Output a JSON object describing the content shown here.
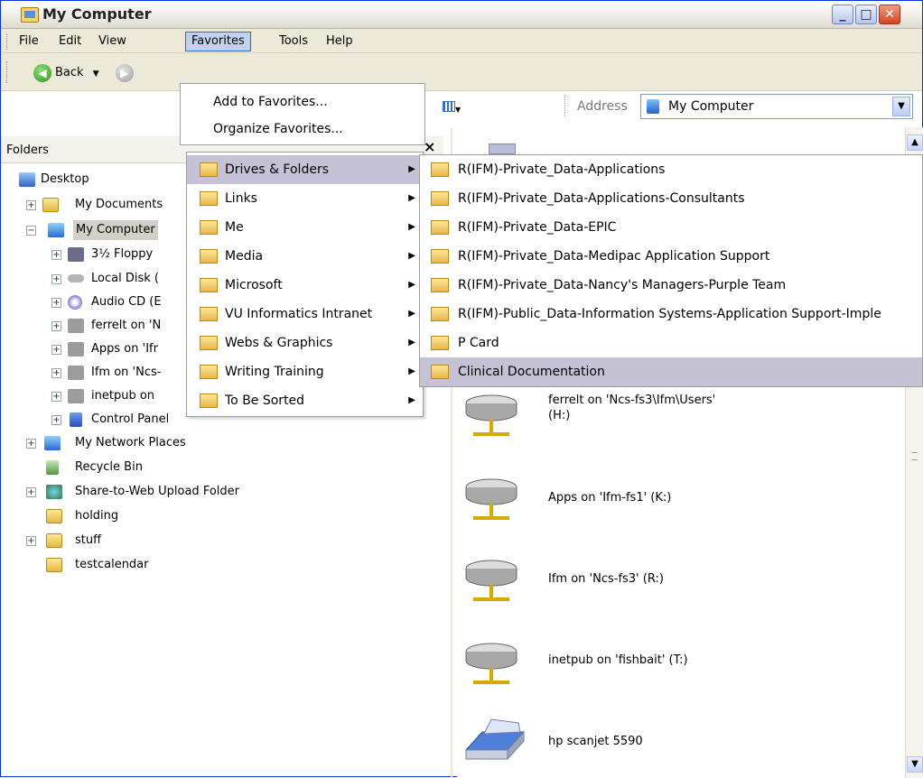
{
  "window": {
    "title": "My Computer"
  },
  "menubar": [
    "File",
    "Edit",
    "View",
    "Favorites",
    "Tools",
    "Help"
  ],
  "toolbar": {
    "back_label": "Back",
    "address_label": "Address",
    "address_value": "My Computer"
  },
  "folders_pane": {
    "header": "Folders"
  },
  "tree": [
    {
      "label": "Desktop"
    },
    {
      "label": "My Documents"
    },
    {
      "label": "My Computer"
    },
    {
      "label": "3½ Floppy"
    },
    {
      "label": "Local Disk ("
    },
    {
      "label": "Audio CD (E"
    },
    {
      "label": "ferrelt on 'N"
    },
    {
      "label": "Apps on 'Ifr"
    },
    {
      "label": "Ifm on 'Ncs-"
    },
    {
      "label": "inetpub on"
    },
    {
      "label": "Control Panel"
    },
    {
      "label": "My Network Places"
    },
    {
      "label": "Recycle Bin"
    },
    {
      "label": "Share-to-Web Upload Folder"
    },
    {
      "label": "holding"
    },
    {
      "label": "stuff"
    },
    {
      "label": "testcalendar"
    }
  ],
  "favorites_menu": {
    "add": "Add to Favorites...",
    "organize": "Organize Favorites..."
  },
  "favorites_folders": [
    "Drives & Folders",
    "Links",
    "Me",
    "Media",
    "Microsoft",
    "VU Informatics Intranet",
    "Webs & Graphics",
    "Writing Training",
    "To Be Sorted"
  ],
  "drives_folders": [
    "R(IFM)-Private_Data-Applications",
    "R(IFM)-Private_Data-Applications-Consultants",
    "R(IFM)-Private_Data-EPIC",
    "R(IFM)-Private_Data-Medipac Application Support",
    "R(IFM)-Private_Data-Nancy's Managers-Purple Team",
    "R(IFM)-Public_Data-Information Systems-Application Support-Imple",
    "P Card",
    "Clinical Documentation"
  ],
  "drives": [
    {
      "line1": "ferrelt on 'Ncs-fs3\\Ifm\\Users'",
      "line2": "(H:)"
    },
    {
      "line1": "Apps on 'Ifm-fs1' (K:)",
      "line2": ""
    },
    {
      "line1": "Ifm on 'Ncs-fs3' (R:)",
      "line2": ""
    },
    {
      "line1": "inetpub on 'fishbait' (T:)",
      "line2": ""
    },
    {
      "line1": "hp scanjet 5590",
      "line2": ""
    }
  ]
}
